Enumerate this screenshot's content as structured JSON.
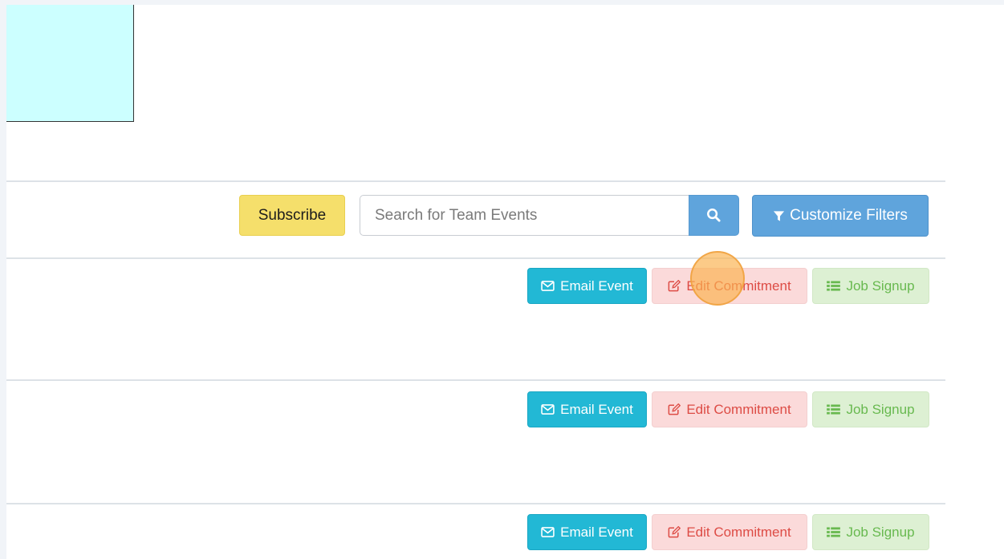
{
  "toolbar": {
    "subscribe_label": "Subscribe",
    "search_placeholder": "Search for Team Events",
    "search_icon": "search-icon",
    "filters_label": "Customize Filters",
    "filters_icon": "filter-icon"
  },
  "events": [
    {
      "email_label": "Email Event",
      "edit_label": "Edit Commitment",
      "job_label": "Job Signup"
    },
    {
      "email_label": "Email Event",
      "edit_label": "Edit Commitment",
      "job_label": "Job Signup"
    },
    {
      "email_label": "Email Event",
      "edit_label": "Edit Commitment",
      "job_label": "Job Signup"
    }
  ],
  "icons": {
    "email": "envelope-icon",
    "edit": "edit-icon",
    "job": "list-icon"
  },
  "colors": {
    "subscribe": "#f5df6b",
    "primary": "#5fa4dc",
    "email": "#22b8d5",
    "edit_bg": "#fbdada",
    "edit_text": "#dd4c45",
    "job_bg": "#ddf0d3",
    "job_text": "#68b94f",
    "logo_bg": "#ccffff"
  }
}
